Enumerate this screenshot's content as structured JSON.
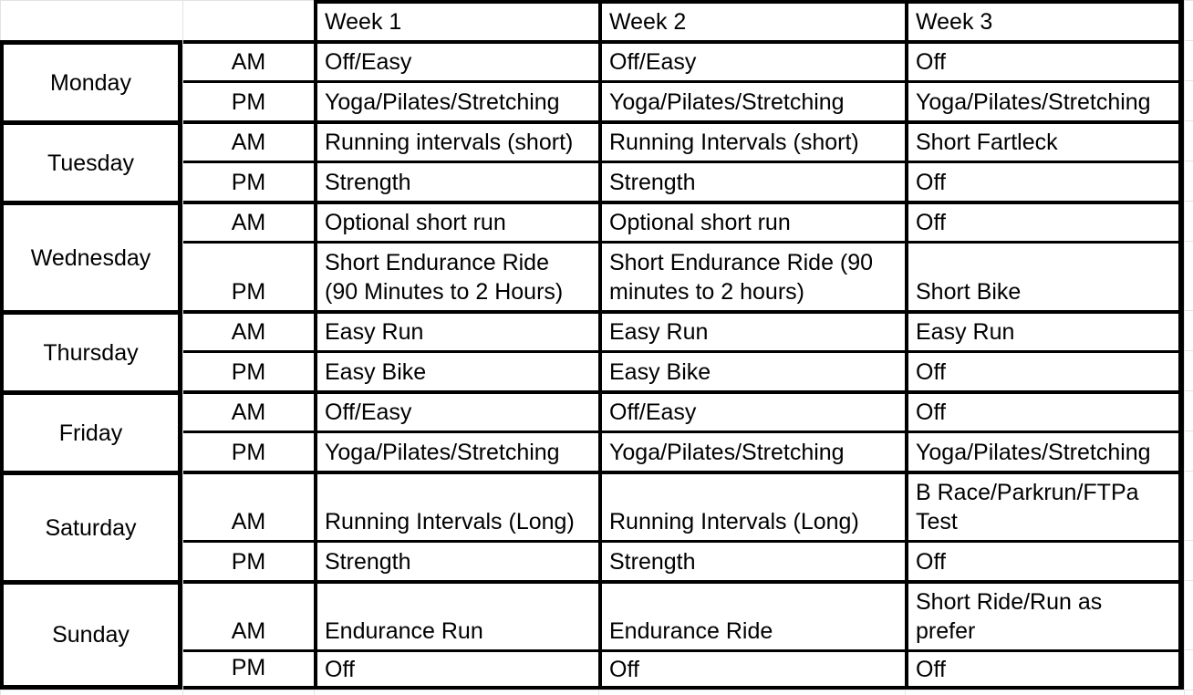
{
  "sheet": {
    "header": {
      "weeks": [
        "Week 1",
        "Week 2",
        "Week 3"
      ]
    },
    "days": [
      {
        "day": "Monday",
        "slots": [
          {
            "period": "AM",
            "weeks": [
              "Off/Easy",
              "Off/Easy",
              "Off"
            ]
          },
          {
            "period": "PM",
            "weeks": [
              "Yoga/Pilates/Stretching",
              "Yoga/Pilates/Stretching",
              "Yoga/Pilates/Stretching"
            ]
          }
        ]
      },
      {
        "day": "Tuesday",
        "slots": [
          {
            "period": "AM",
            "weeks": [
              "Running intervals (short)",
              "Running Intervals (short)",
              "Short Fartleck"
            ]
          },
          {
            "period": "PM",
            "weeks": [
              "Strength",
              "Strength",
              "Off"
            ]
          }
        ]
      },
      {
        "day": "Wednesday",
        "slots": [
          {
            "period": "AM",
            "weeks": [
              "Optional short run",
              "Optional short run",
              "Off"
            ]
          },
          {
            "period": "PM",
            "weeks": [
              "Short Endurance Ride\n(90 Minutes to 2 Hours)",
              "Short Endurance Ride (90\nminutes to 2 hours)",
              "Short Bike"
            ]
          }
        ]
      },
      {
        "day": "Thursday",
        "slots": [
          {
            "period": "AM",
            "weeks": [
              "Easy Run",
              "Easy Run",
              "Easy Run"
            ]
          },
          {
            "period": "PM",
            "weeks": [
              "Easy Bike",
              "Easy Bike",
              "Off"
            ]
          }
        ]
      },
      {
        "day": "Friday",
        "slots": [
          {
            "period": "AM",
            "weeks": [
              "Off/Easy",
              "Off/Easy",
              "Off"
            ]
          },
          {
            "period": "PM",
            "weeks": [
              "Yoga/Pilates/Stretching",
              "Yoga/Pilates/Stretching",
              "Yoga/Pilates/Stretching"
            ]
          }
        ]
      },
      {
        "day": "Saturday",
        "slots": [
          {
            "period": "AM",
            "weeks": [
              "Running Intervals (Long)",
              "Running Intervals (Long)",
              "B Race/Parkrun/FTPa\nTest"
            ]
          },
          {
            "period": "PM",
            "weeks": [
              "Strength",
              "Strength",
              "Off"
            ]
          }
        ]
      },
      {
        "day": "Sunday",
        "slots": [
          {
            "period": "AM",
            "weeks": [
              "Endurance Run",
              "Endurance Ride",
              "Short Ride/Run as\nprefer"
            ]
          },
          {
            "period": "PM",
            "weeks": [
              "Off",
              "Off",
              "Off"
            ]
          }
        ]
      }
    ]
  }
}
